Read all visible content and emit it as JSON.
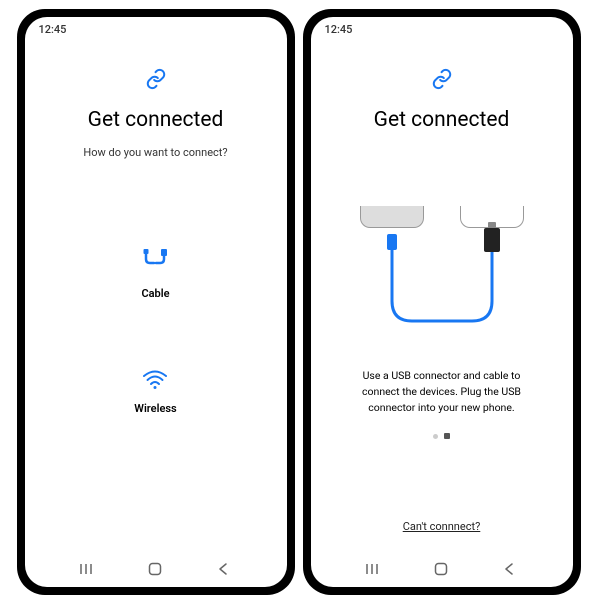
{
  "status": {
    "time": "12:45"
  },
  "screen1": {
    "title": "Get connected",
    "subtitle": "How do you want to connect?",
    "options": {
      "cable": "Cable",
      "wireless": "Wireless"
    }
  },
  "screen2": {
    "title": "Get connected",
    "instruction": "Use a USB connector and cable to connect the devices. Plug the USB connector into your new phone.",
    "help_link": "Can't connnect?"
  },
  "colors": {
    "accent": "#1877f2"
  }
}
